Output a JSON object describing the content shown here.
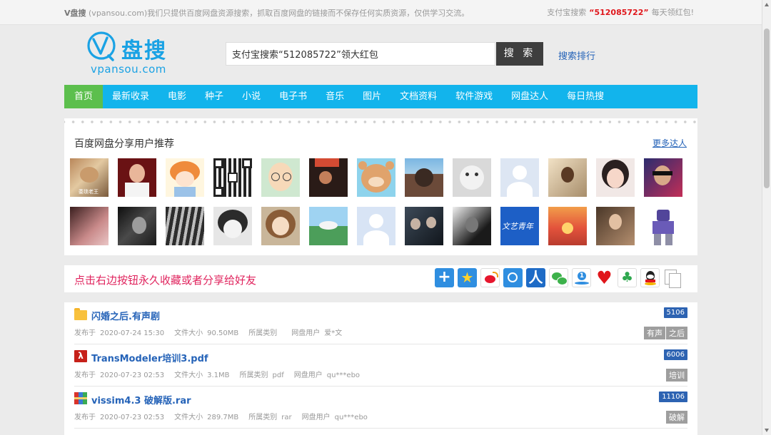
{
  "topbar": {
    "site_name": "V盘搜",
    "notice": " (vpansou.com)我们只提供百度网盘资源搜索，抓取百度网盘的链接而不保存任何实质资源，仅供学习交流。",
    "promo_prefix": "支付宝搜索",
    "promo_code": "“512085722”",
    "promo_suffix": "每天领红包!"
  },
  "logo": {
    "name": "盘搜",
    "domain": "vpansou.com"
  },
  "search": {
    "value": "支付宝搜索“512085722”领大红包",
    "button_label": "搜 索",
    "rank_link": "搜索排行"
  },
  "nav": {
    "items": [
      "首页",
      "最新收录",
      "电影",
      "种子",
      "小说",
      "电子书",
      "音乐",
      "图片",
      "文档资料",
      "软件游戏",
      "网盘达人",
      "每日热搜"
    ],
    "active_index": 0
  },
  "users": {
    "title": "百度网盘分享用户推荐",
    "more_link": "更多达人",
    "avatar_captions": {
      "first": "委琐老王",
      "mao": "文艺青年"
    }
  },
  "share": {
    "text": "点击右边按钮永久收藏或者分享给好友",
    "icons": [
      "plus-share-icon",
      "qzone-icon",
      "weibo-icon",
      "tencent-weibo-icon",
      "renren-icon",
      "wechat-icon",
      "douban-icon",
      "favorite-heart-icon",
      "clover-icon",
      "qq-icon",
      "copy-icon"
    ]
  },
  "results": [
    {
      "icon": "folder-icon",
      "title": "闪婚之后.有声剧",
      "count": "5106",
      "date_label": "发布于",
      "date": "2020-07-24 15:30",
      "size_label": "文件大小",
      "size": "90.50MB",
      "category_label": "所属类别",
      "category": "",
      "user_label": "网盘用户",
      "user": "爱*文",
      "tags": [
        "有声",
        "之后"
      ]
    },
    {
      "icon": "pdf-icon",
      "title": "TransModeler培训3.pdf",
      "count": "6006",
      "date_label": "发布于",
      "date": "2020-07-23 02:53",
      "size_label": "文件大小",
      "size": "3.1MB",
      "category_label": "所属类别",
      "category": "pdf",
      "user_label": "网盘用户",
      "user": "qu***ebo",
      "tags": [
        "培训"
      ]
    },
    {
      "icon": "rar-archive-icon",
      "title": "vissim4.3 破解版.rar",
      "count": "11106",
      "date_label": "发布于",
      "date": "2020-07-23 02:53",
      "size_label": "文件大小",
      "size": "289.7MB",
      "category_label": "所属类别",
      "category": "rar",
      "user_label": "网盘用户",
      "user": "qu***ebo",
      "tags": [
        "破解"
      ]
    }
  ],
  "colors": {
    "nav_bg": "#12b4ec",
    "nav_active": "#5cbf4d",
    "link": "#2563b8",
    "share_text": "#e0245e",
    "promo_code": "#e0161b",
    "badge": "#2d63b2",
    "tag": "#9e9e9e"
  }
}
